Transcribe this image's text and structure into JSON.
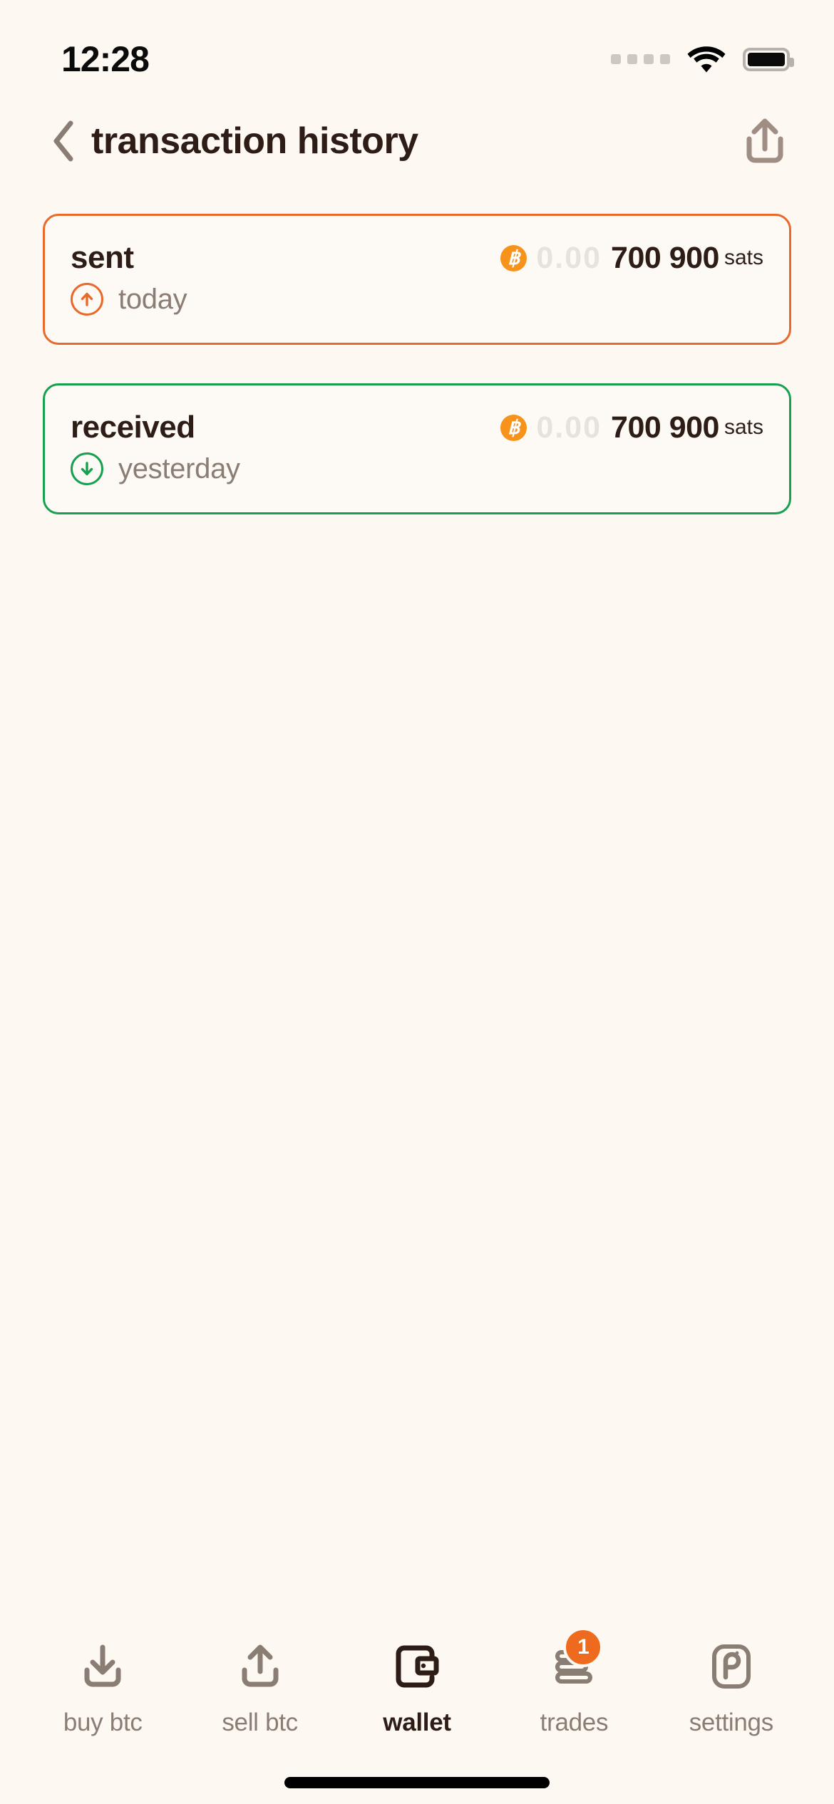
{
  "status_bar": {
    "time": "12:28",
    "signal_icon": "signal-dots-icon",
    "wifi_icon": "wifi-icon",
    "battery_icon": "battery-full-icon"
  },
  "header": {
    "back_icon": "chevron-left-icon",
    "title": "transaction history",
    "share_icon": "share-upload-icon"
  },
  "transactions": [
    {
      "label": "sent",
      "direction_icon": "arrow-up-circle-icon",
      "date": "yesterday_or_today",
      "date_text": "today",
      "currency_icon": "bitcoin-coin-icon",
      "amount_dim": "0.00",
      "amount_main": "700 900",
      "unit": "sats",
      "accent": "#e8692a"
    },
    {
      "label": "received",
      "direction_icon": "arrow-down-circle-icon",
      "date_text": "yesterday",
      "currency_icon": "bitcoin-coin-icon",
      "amount_dim": "0.00",
      "amount_main": "700 900",
      "unit": "sats",
      "accent": "#17a04f"
    }
  ],
  "tabbar": {
    "items": [
      {
        "label": "buy btc",
        "icon": "download-tray-icon",
        "active": false
      },
      {
        "label": "sell btc",
        "icon": "upload-tray-icon",
        "active": false
      },
      {
        "label": "wallet",
        "icon": "wallet-icon",
        "active": true
      },
      {
        "label": "trades",
        "icon": "coins-stack-icon",
        "active": false,
        "badge": "1"
      },
      {
        "label": "settings",
        "icon": "pocket-p-icon",
        "active": false
      }
    ]
  },
  "colors": {
    "background": "#fdf8f2",
    "text_dark": "#2e1d16",
    "text_muted": "#8a7d74",
    "orange": "#e8692a",
    "green": "#17a04f",
    "bitcoin_orange": "#f7931a",
    "badge_orange": "#ee6a1e"
  }
}
